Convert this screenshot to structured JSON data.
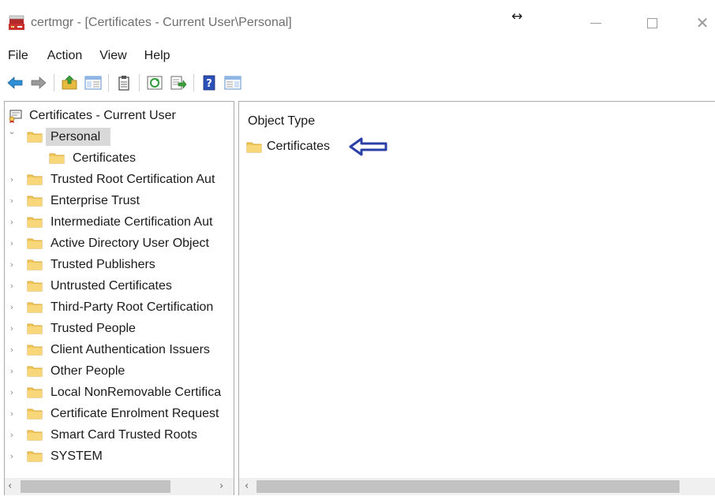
{
  "window": {
    "title": "certmgr - [Certificates - Current User\\Personal]",
    "resize_cursor": "↔",
    "close_glyph": "✕"
  },
  "menu": [
    "File",
    "Action",
    "View",
    "Help"
  ],
  "toolbar": {
    "icons": [
      "back-icon",
      "forward-icon",
      "up-folder-icon",
      "show-hide-tree-icon",
      "properties-icon",
      "refresh-icon",
      "export-list-icon",
      "help-icon",
      "action-pane-icon"
    ]
  },
  "tree": {
    "root": "Certificates - Current User",
    "items": [
      {
        "label": "Personal",
        "expanded": true,
        "selected": true
      },
      {
        "label": "Certificates",
        "child": true
      },
      {
        "label": "Trusted Root Certification Aut"
      },
      {
        "label": "Enterprise Trust"
      },
      {
        "label": "Intermediate Certification Aut"
      },
      {
        "label": "Active Directory User Object"
      },
      {
        "label": "Trusted Publishers"
      },
      {
        "label": "Untrusted Certificates"
      },
      {
        "label": "Third-Party Root Certification"
      },
      {
        "label": "Trusted People"
      },
      {
        "label": "Client Authentication Issuers"
      },
      {
        "label": "Other People"
      },
      {
        "label": "Local NonRemovable Certifica"
      },
      {
        "label": "Certificate Enrolment Request"
      },
      {
        "label": "Smart Card Trusted Roots"
      },
      {
        "label": "SYSTEM"
      }
    ]
  },
  "right_pane": {
    "column_header": "Object Type",
    "items": [
      "Certificates"
    ]
  },
  "scrollbar": {
    "left_arrow": "‹",
    "right_arrow": "›"
  },
  "colors": {
    "folder": "#f2c85b",
    "folder_dark": "#d9a93a",
    "annotation_arrow": "#2b3fa8",
    "selection": "#d9d9d9"
  }
}
